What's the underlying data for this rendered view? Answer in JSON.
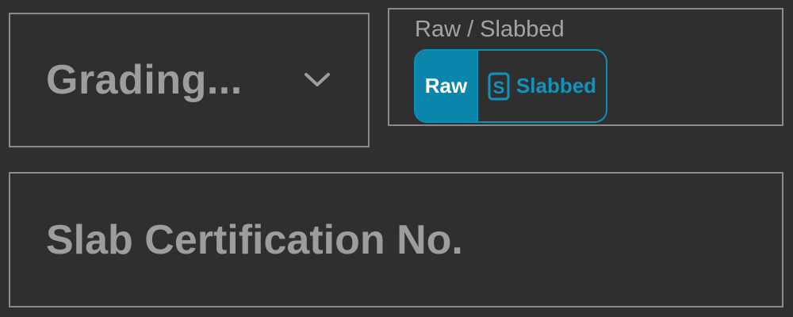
{
  "grading": {
    "selected_value": "Grading...",
    "icon": "chevron-down-icon"
  },
  "type_toggle": {
    "label": "Raw / Slabbed",
    "options": [
      {
        "label": "Raw",
        "selected": true
      },
      {
        "label": "Slabbed",
        "selected": false,
        "icon": "slab-icon"
      }
    ]
  },
  "certification": {
    "value": "",
    "placeholder": "Slab Certification No."
  },
  "colors": {
    "background": "#2f2f2f",
    "border": "#8a8a8a",
    "accent": "#0a86ac",
    "muted_text": "#9d9d9d"
  }
}
